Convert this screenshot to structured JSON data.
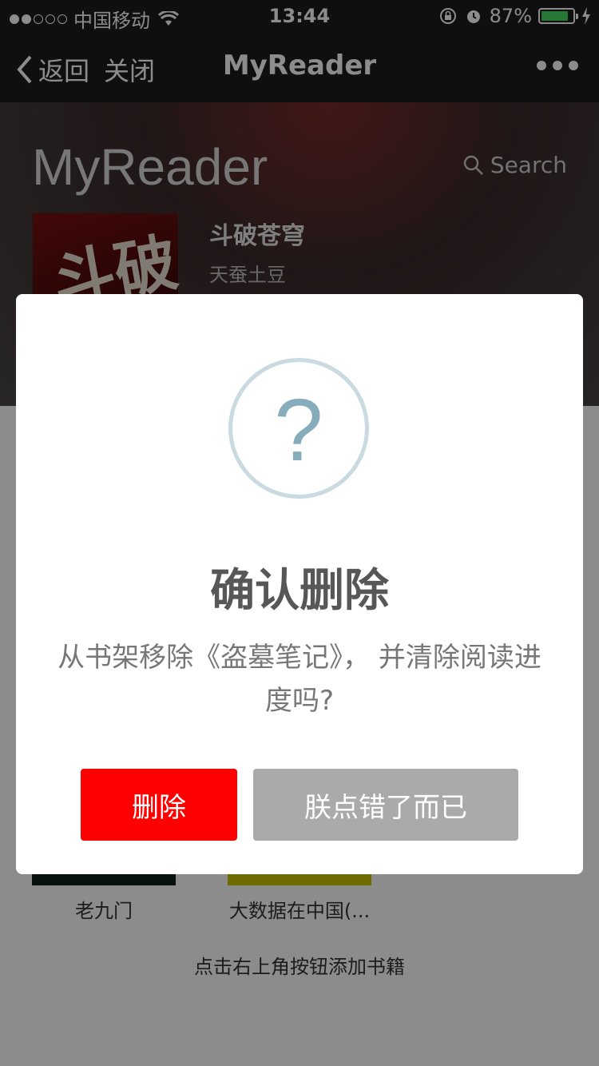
{
  "status_bar": {
    "carrier": "中国移动",
    "time": "13:44",
    "battery_percent": "87%",
    "battery_level": 0.87
  },
  "nav": {
    "back_label": "返回",
    "close_label": "关闭",
    "title": "MyReader"
  },
  "header": {
    "brand": "MyReader",
    "search_label": "Search"
  },
  "featured_book": {
    "title": "斗破苍穹",
    "author": "天蚕土豆",
    "cover_glyph": "斗破"
  },
  "shelf": {
    "books": [
      {
        "title": "老九门"
      },
      {
        "title": "大数据在中国(..."
      }
    ],
    "hint": "点击右上角按钮添加书籍"
  },
  "dialog": {
    "icon": "question-icon",
    "title": "确认删除",
    "message": "从书架移除《盗墓笔记》， 并清除阅读进度吗?",
    "confirm_label": "删除",
    "cancel_label": "朕点错了而已"
  },
  "colors": {
    "confirm": "#ff0000",
    "cancel": "#aaaaaa",
    "question_ring": "#c9dae1",
    "question_mark": "#87adbd"
  }
}
